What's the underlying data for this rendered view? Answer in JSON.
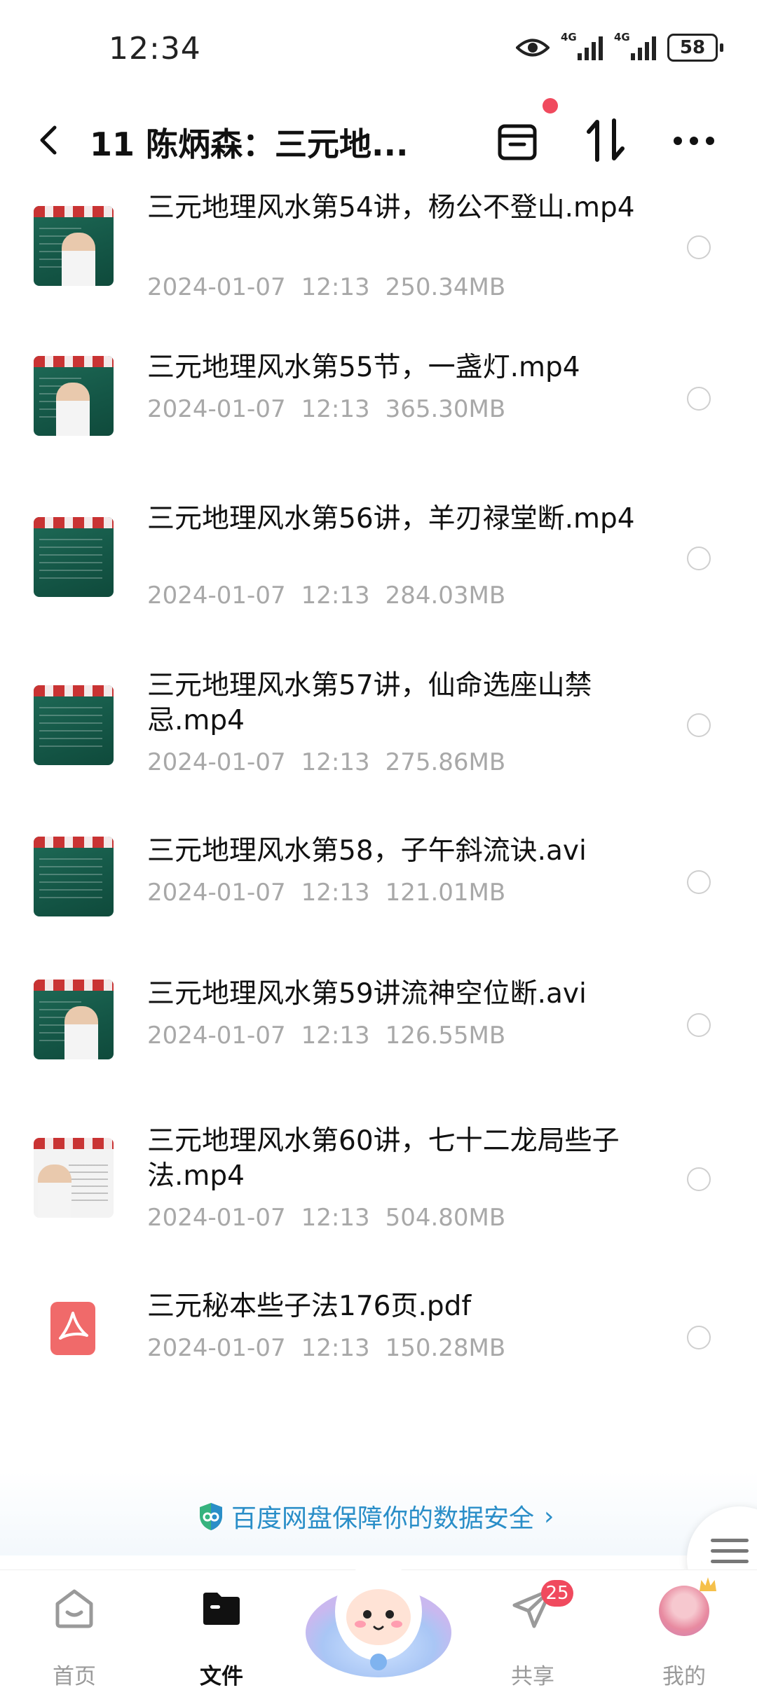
{
  "status_bar": {
    "time": "12:34",
    "network_1": "4G",
    "network_2": "4G",
    "battery": "58"
  },
  "header": {
    "title": "11 陈炳森：三元地..."
  },
  "files": [
    {
      "name": "三元地理风水第54讲，杨公不登山.mp4",
      "date": "2024-01-07",
      "time": "12:13",
      "size": "250.34MB",
      "type": "video"
    },
    {
      "name": "三元地理风水第55节，一盏灯.mp4",
      "date": "2024-01-07",
      "time": "12:13",
      "size": "365.30MB",
      "type": "video"
    },
    {
      "name": "三元地理风水第56讲，羊刃禄堂断.mp4",
      "date": "2024-01-07",
      "time": "12:13",
      "size": "284.03MB",
      "type": "video"
    },
    {
      "name": "三元地理风水第57讲，仙命选座山禁忌.mp4",
      "date": "2024-01-07",
      "time": "12:13",
      "size": "275.86MB",
      "type": "video"
    },
    {
      "name": "三元地理风水第58，子午斜流诀.avi",
      "date": "2024-01-07",
      "time": "12:13",
      "size": "121.01MB",
      "type": "video"
    },
    {
      "name": "三元地理风水第59讲流神空位断.avi",
      "date": "2024-01-07",
      "time": "12:13",
      "size": "126.55MB",
      "type": "video"
    },
    {
      "name": "三元地理风水第60讲，七十二龙局些子法.mp4",
      "date": "2024-01-07",
      "time": "12:13",
      "size": "504.80MB",
      "type": "video"
    },
    {
      "name": "三元秘本些子法176页.pdf",
      "date": "2024-01-07",
      "time": "12:13",
      "size": "150.28MB",
      "type": "pdf"
    }
  ],
  "banner": {
    "text": "百度网盘保障你的数据安全",
    "chevron": "›"
  },
  "tabs": {
    "home": "首页",
    "files": "文件",
    "share": "共享",
    "share_badge": "25",
    "mine": "我的"
  },
  "colors": {
    "accent": "#2a8ec8",
    "badge": "#f04a5e",
    "meta_text": "#a8a8a8"
  }
}
